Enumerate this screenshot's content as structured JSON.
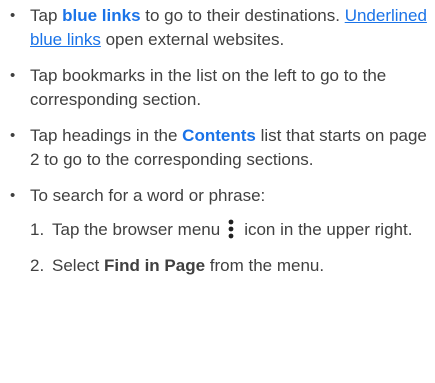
{
  "items": [
    {
      "prefix": "Tap ",
      "link_bold": "blue links",
      "mid": " to go to their destinations. ",
      "link_underline": "Underlined blue links",
      "suffix": " open external websites."
    },
    {
      "text": "Tap bookmarks in the list on the left to go to the corresponding section."
    },
    {
      "prefix": "Tap headings in the ",
      "link_bold": "Contents",
      "suffix": " list that starts on page 2 to go to the corresponding sections."
    },
    {
      "text": "To search for a word or phrase:",
      "steps": [
        {
          "num": "1.",
          "prefix": "Tap the browser menu",
          "icon": "more-vertical-icon",
          "suffix": "icon in the upper right."
        },
        {
          "num": "2.",
          "prefix": "Select ",
          "strong": "Find in Page",
          "suffix": " from the menu."
        }
      ]
    }
  ],
  "colors": {
    "link": "#1a73e8",
    "text": "#404040",
    "bullet": "#404040"
  }
}
